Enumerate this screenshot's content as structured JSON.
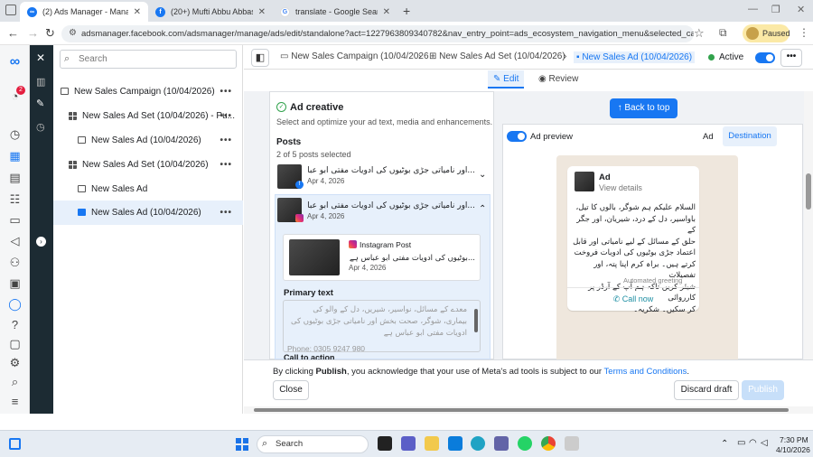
{
  "browser": {
    "tabs": [
      {
        "title": "(2) Ads Manager - Manage ads",
        "color": "#1877f2"
      },
      {
        "title": "(20+) Mufti Abbu Abbas | Facebook",
        "color": "#1877f2"
      },
      {
        "title": "translate - Google Search",
        "color": "#34a853"
      }
    ],
    "new_tab": "+",
    "url": "adsmanager.facebook.com/adsmanager/manage/ads/edit/standalone?act=1227963809340782&nav_entry_point=ads_ecosystem_navigation_menu&selected_campaign_ids=12024112...",
    "paused_label": "Paused"
  },
  "rail": {
    "notification_count": "2"
  },
  "sidebar": {
    "search_placeholder": "Search",
    "items": [
      {
        "label": "New Sales Campaign (10/04/2026)",
        "level": 0
      },
      {
        "label": "New Sales Ad Set (10/04/2026) - Pu...",
        "level": 1
      },
      {
        "label": "New Sales Ad (10/04/2026)",
        "level": 2
      },
      {
        "label": "New Sales Ad Set (10/04/2026)",
        "level": 1
      },
      {
        "label": "New Sales Ad",
        "level": 2
      },
      {
        "label": "New Sales Ad (10/04/2026)",
        "level": 2,
        "selected": true
      }
    ],
    "more": "•••"
  },
  "breadcrumb": {
    "campaign": "New Sales Campaign (10/04/2026",
    "adset": "New Sales Ad Set (10/04/2026)",
    "ad": "New Sales Ad (10/04/2026)"
  },
  "status": {
    "label": "Active"
  },
  "modes": {
    "edit": "Edit",
    "review": "Review"
  },
  "creative": {
    "title": "Ad creative",
    "subtitle": "Select and optimize your ad text, media and enhancements.",
    "posts_label": "Posts",
    "posts_count": "2 of 5 posts selected",
    "posts": [
      {
        "text": "...اور نامیاتی جڑی بوٹیوں کی ادویات مفتی ابو عباس ہے",
        "date": "Apr 4, 2026"
      },
      {
        "text": "...اور نامیاتی جڑی بوٹیوں کی ادویات مفتی ابو عباس ہے",
        "date": "Apr 4, 2026"
      }
    ],
    "instagram_post_label": "Instagram Post",
    "instagram_post_text": "...بوٹیوں کی ادویات مفتی ابو عباس ہے",
    "instagram_post_date": "Apr 4, 2026",
    "primary_text_label": "Primary text",
    "primary_text_lines": [
      "معدے کے مسائل، نواسیر، شیریں، دل کے والو کی",
      "بیماری، شوگر، صحت بخش اور نامیاتی جڑی بوٹیوں کی",
      "ادویات مفتی ابو عباس ہے"
    ],
    "phone_line": "Phone: 0305 9247 980",
    "cta_label": "Call to action"
  },
  "preview": {
    "back_to_top": "Back to top",
    "toggle_label": "Ad preview",
    "tab_ad": "Ad",
    "tab_destination": "Destination",
    "card_title": "Ad",
    "card_sub": "View details",
    "message_lines": [
      "السلام علیکم ہم شوگر، بالوں کا تیل،",
      "باواسیر، دل کے درد، شیریان، اور جگر کے",
      "حلق کے مسائل کے لیے نامیاتی اور قابل",
      "اعتماد جڑی بوٹیوں کی ادویات فروخت",
      "کرتے ہیں۔ براہ کرم اپنا پتہ، اور تفصیلات",
      "شیئر کریں تاکہ ہم آپ کے آرڈر پر کارروائی",
      "کر سکیں۔ شکریہ۔"
    ],
    "automated": "Automated greeting",
    "call_now": "Call now"
  },
  "footer": {
    "notice_pre": "By clicking ",
    "notice_bold": "Publish",
    "notice_mid": ", you acknowledge that your use of Meta's ad tools is subject to our ",
    "notice_link": "Terms and Conditions",
    "notice_end": ".",
    "close": "Close",
    "discard": "Discard draft",
    "publish": "Publish"
  },
  "taskbar": {
    "search": "Search",
    "time": "7:30 PM",
    "date": "4/10/2026"
  },
  "colors": {
    "brand": "#1877f2",
    "rail_dark": "#1c2b33"
  }
}
